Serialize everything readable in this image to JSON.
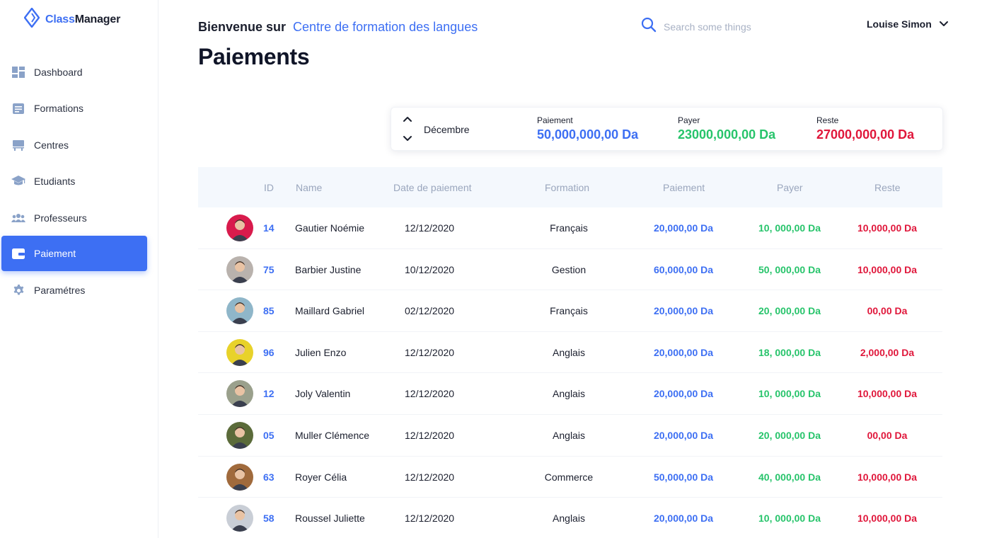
{
  "brand": {
    "name_part1": "Class",
    "name_part2": "Manager",
    "accent": "#3d6ff3"
  },
  "sidebar": {
    "items": [
      {
        "label": "Dashboard",
        "icon": "dashboard-icon",
        "active": false
      },
      {
        "label": "Formations",
        "icon": "document-icon",
        "active": false
      },
      {
        "label": "Centres",
        "icon": "building-icon",
        "active": false
      },
      {
        "label": "Etudiants",
        "icon": "graduation-cap-icon",
        "active": false
      },
      {
        "label": "Professeurs",
        "icon": "people-icon",
        "active": false
      },
      {
        "label": "Paiement",
        "icon": "wallet-icon",
        "active": true
      },
      {
        "label": "Paramétres",
        "icon": "gear-icon",
        "active": false
      }
    ]
  },
  "header": {
    "welcome_prefix": "Bienvenue sur",
    "welcome_place": "Centre de formation des langues",
    "title": "Paiements",
    "search_placeholder": "Search some things",
    "user_name": "Louise Simon"
  },
  "summary": {
    "month": "Décembre",
    "paiement_label": "Paiement",
    "paiement_value": "50,000,000,00 Da",
    "payer_label": "Payer",
    "payer_value": "23000,000,00 Da",
    "reste_label": "Reste",
    "reste_value": "27000,000,00 Da"
  },
  "colors": {
    "blue": "#3d6ff3",
    "green": "#27c46b",
    "red": "#e0173b"
  },
  "table": {
    "columns": [
      "ID",
      "Name",
      "Date de paiement",
      "Formation",
      "Paiement",
      "Payer",
      "Reste"
    ],
    "rows": [
      {
        "id": "14",
        "name": "Gautier Noémie",
        "date": "12/12/2020",
        "formation": "Français",
        "paiement": "20,000,00 Da",
        "payer": "10, 000,00 Da",
        "reste": "10,000,00 Da",
        "avatar_bg": "#d81b4c"
      },
      {
        "id": "75",
        "name": "Barbier Justine",
        "date": "10/12/2020",
        "formation": "Gestion",
        "paiement": "60,000,00 Da",
        "payer": "50, 000,00 Da",
        "reste": "10,000,00 Da",
        "avatar_bg": "#b9b2ad"
      },
      {
        "id": "85",
        "name": "Maillard Gabriel",
        "date": "02/12/2020",
        "formation": "Français",
        "paiement": "20,000,00 Da",
        "payer": "20, 000,00 Da",
        "reste": "00,00 Da",
        "avatar_bg": "#8fb6c9"
      },
      {
        "id": "96",
        "name": "Julien Enzo",
        "date": "12/12/2020",
        "formation": "Anglais",
        "paiement": "20,000,00 Da",
        "payer": "18, 000,00 Da",
        "reste": "2,000,00 Da",
        "avatar_bg": "#e8d22a"
      },
      {
        "id": "12",
        "name": "Joly Valentin",
        "date": "12/12/2020",
        "formation": "Anglais",
        "paiement": "20,000,00 Da",
        "payer": "10, 000,00 Da",
        "reste": "10,000,00 Da",
        "avatar_bg": "#9aa08c"
      },
      {
        "id": "05",
        "name": "Muller Clémence",
        "date": "12/12/2020",
        "formation": "Anglais",
        "paiement": "20,000,00 Da",
        "payer": "20, 000,00 Da",
        "reste": "00,00 Da",
        "avatar_bg": "#5b6b3a"
      },
      {
        "id": "63",
        "name": "Royer Célia",
        "date": "12/12/2020",
        "formation": "Commerce",
        "paiement": "50,000,00 Da",
        "payer": "40, 000,00 Da",
        "reste": "10,000,00 Da",
        "avatar_bg": "#a06a3c"
      },
      {
        "id": "58",
        "name": "Roussel Juliette",
        "date": "12/12/2020",
        "formation": "Anglais",
        "paiement": "20,000,00 Da",
        "payer": "10, 000,00 Da",
        "reste": "10,000,00 Da",
        "avatar_bg": "#c9ced6"
      }
    ]
  }
}
